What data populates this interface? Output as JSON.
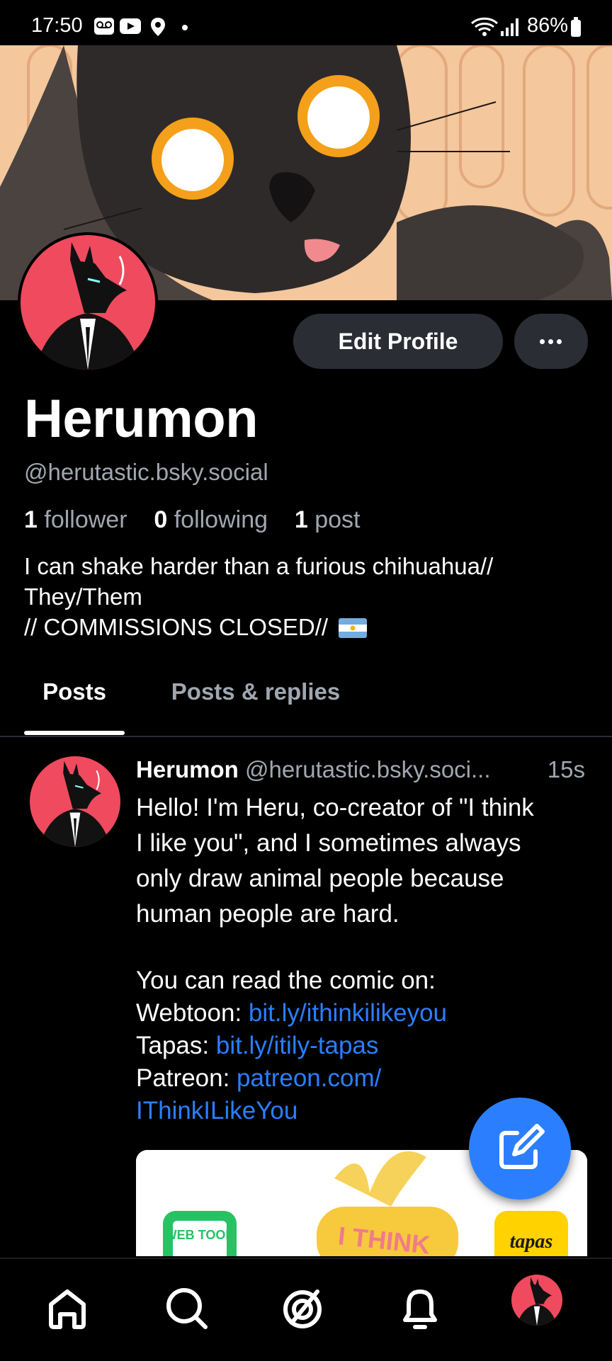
{
  "status_bar": {
    "time": "17:50",
    "battery": "86%",
    "icons": [
      "voicemail-icon",
      "youtube-icon",
      "location-icon",
      "dot-icon",
      "wifi-icon",
      "signal-icon",
      "battery-icon"
    ]
  },
  "profile": {
    "edit_button": "Edit Profile",
    "display_name": "Herumon",
    "handle": "@herutastic.bsky.social",
    "stats": {
      "followers_count": "1",
      "followers_label": "follower",
      "following_count": "0",
      "following_label": "following",
      "posts_count": "1",
      "posts_label": "post"
    },
    "bio": {
      "line1": "I can shake harder than a furious chihuahua//",
      "line2": "They/Them",
      "line3": "// COMMISSIONS CLOSED//"
    }
  },
  "tabs": [
    {
      "label": "Posts",
      "active": true
    },
    {
      "label": "Posts & replies",
      "active": false
    }
  ],
  "post": {
    "author": "Herumon",
    "handle": "@herutastic.bsky.soci...",
    "time": "15s",
    "body_lines": [
      "Hello! I'm Heru, co-creator of \"I think",
      "I like you\", and I sometimes always",
      "only draw animal people because",
      "human people are hard."
    ],
    "intro": "You can read the comic on:",
    "links": {
      "webtoon_label": "Webtoon: ",
      "webtoon_url": "bit.ly/ithinkilikeyou",
      "tapas_label": "Tapas: ",
      "tapas_url": "bit.ly/itily-tapas",
      "patreon_label": "Patreon: ",
      "patreon_url_1": "patreon.com/",
      "patreon_url_2": "IThinkILikeYou"
    },
    "image": {
      "webtoon_logo": "WEB TOON",
      "title_text": "I THINK",
      "tapas_logo": "tapas"
    }
  },
  "colors": {
    "accent": "#2b7fff",
    "link": "#2a7fff",
    "avatar_bg": "#ef4a5e",
    "button_bg": "#2a2d33",
    "muted_text": "#a0a7b0"
  },
  "nav": [
    "home-icon",
    "search-icon",
    "feeds-icon",
    "notifications-icon",
    "profile-avatar"
  ]
}
